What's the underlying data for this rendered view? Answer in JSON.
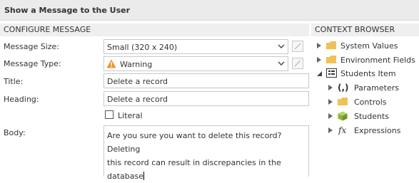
{
  "window": {
    "title": "Show a Message to the User"
  },
  "configure": {
    "header": "CONFIGURE MESSAGE",
    "size": {
      "label": "Message Size:",
      "value": "Small (320 x 240)"
    },
    "type": {
      "label": "Message Type:",
      "value": "Warning"
    },
    "title": {
      "label": "Title:",
      "value": "Delete a record"
    },
    "heading": {
      "label": "Heading:",
      "value": "Delete a record"
    },
    "literal": {
      "label": "Literal",
      "checked": false
    },
    "body": {
      "label": "Body:",
      "line1": "Are you sure you want to delete this record? Deleting",
      "line2": "this record can result in discrepancies in the database"
    }
  },
  "context": {
    "header": "CONTEXT BROWSER",
    "items": [
      {
        "label": "System Values",
        "icon": "folder-icon",
        "expanded": false
      },
      {
        "label": "Environment Fields",
        "icon": "folder-icon",
        "expanded": false
      },
      {
        "label": "Students Item",
        "icon": "form-item-icon",
        "expanded": true
      },
      {
        "label": "Parameters",
        "icon": "parameters-icon",
        "expanded": false
      },
      {
        "label": "Controls",
        "icon": "folder-icon",
        "expanded": false
      },
      {
        "label": "Students",
        "icon": "cube-icon",
        "expanded": false
      },
      {
        "label": "Expressions",
        "icon": "fx-icon",
        "expanded": false
      }
    ]
  },
  "colors": {
    "folder": "#f0c15a",
    "cube": "#8db43a",
    "warning": "#e8952b",
    "field_border": "#c8c8c8"
  }
}
